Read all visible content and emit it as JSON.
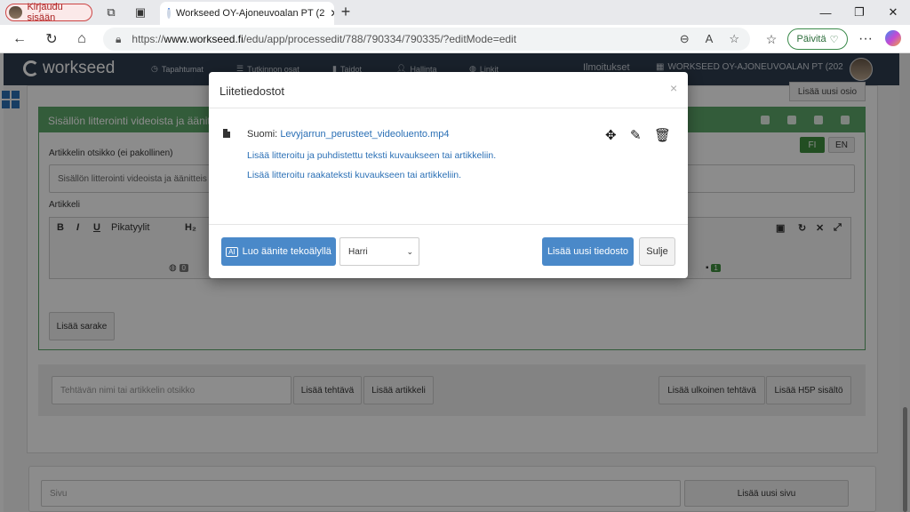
{
  "browser": {
    "profile_label": "Kirjaudu sisään",
    "tab_title": "Workseed OY-Ajoneuvoalan PT (2",
    "url_prefix": "https://",
    "url_domain": "www.workseed.fi",
    "url_path": "/edu/app/processedit/788/790334/790335/?editMode=edit",
    "update_button": "Päivitä",
    "new_tab": "+"
  },
  "site": {
    "logo": "workseed",
    "nav": [
      "Tapahtumat",
      "Tutkinnon osat",
      "Taidot",
      "Hallinta",
      "Linkit"
    ],
    "notifications": "Ilmoitukset",
    "org": "WORKSEED OY-AJONEUVOALAN PT (202"
  },
  "page": {
    "add_section": "Lisää uusi osio",
    "panel_title": "Sisällön litterointi videoista ja äänitt",
    "lang_fi": "FI",
    "lang_en": "EN",
    "article_title_label": "Artikkelin otsikko (ei pakollinen)",
    "article_title_value": "Sisällön litterointi videoista ja äänitteis",
    "article_label": "Artikkeli",
    "quickstyles": "Pikatyylit",
    "heading": "H₂",
    "badge_left": "0",
    "badge_right": "1",
    "add_column": "Lisää sarake",
    "task_placeholder": "Tehtävän nimi tai artikkelin otsikko",
    "add_task": "Lisää tehtävä",
    "add_article": "Lisää artikkeli",
    "add_external": "Lisää ulkoinen tehtävä",
    "add_h5p": "Lisää H5P sisältö",
    "page_placeholder": "Sivu",
    "add_page": "Lisää uusi sivu"
  },
  "modal": {
    "title": "Liitetiedostot",
    "close": "×",
    "file_lang": "Suomi:",
    "file_name": "Levyjarrun_perusteet_videoluento.mp4",
    "link_clean": "Lisää litteroitu ja puhdistettu teksti kuvaukseen tai artikkeliin.",
    "link_raw": "Lisää litteroitu raakateksti kuvaukseen tai artikkeliin.",
    "ai_button": "Luo äänite tekoälyllä",
    "ai_badge": "AI",
    "voice_selected": "Harri",
    "add_file": "Lisää uusi tiedosto",
    "close_button": "Sulje"
  }
}
